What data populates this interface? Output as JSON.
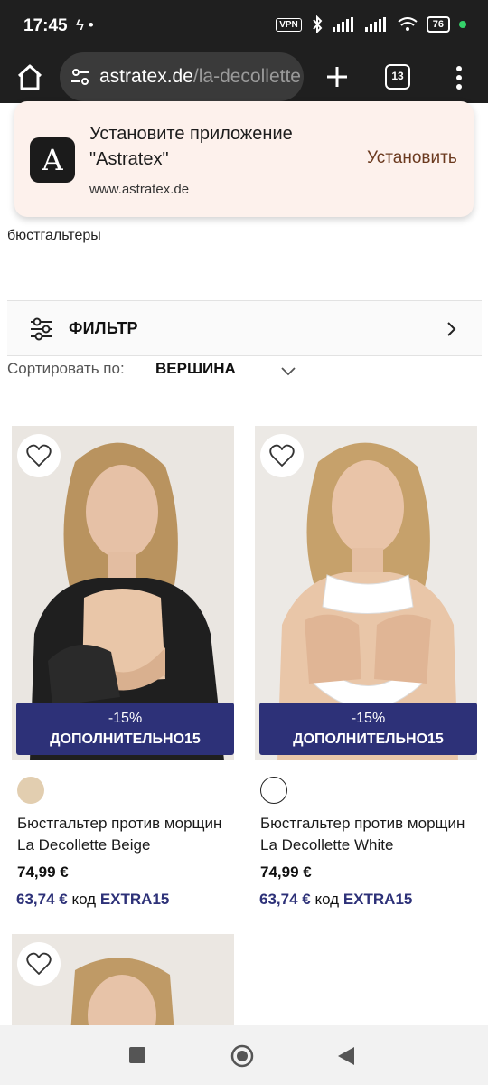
{
  "status_bar": {
    "time": "17:45",
    "vpn": "VPN",
    "battery": "76"
  },
  "browser": {
    "url_domain": "astratex.de",
    "url_path": "/la-decollette",
    "tab_count": "13"
  },
  "install_banner": {
    "title": "Установите приложение \"Astratex\"",
    "url": "www.astratex.de",
    "install_label": "Установить",
    "app_letter": "A"
  },
  "page": {
    "breadcrumb_link": "бюстгальтеры",
    "filter_label": "ФИЛЬТР",
    "sort_label": "Сортировать по:",
    "sort_value": "ВЕРШИНА"
  },
  "products": [
    {
      "name": "Бюстгальтер против морщин La Decollette Beige",
      "price": "74,99 €",
      "sale_price": "63,74 €",
      "code_label": "код",
      "code": "EXTRA15",
      "badge_line1": "-15%",
      "badge_line2": "ДОПОЛНИТЕЛЬНО15",
      "swatch_color": "#e2ceb0"
    },
    {
      "name": "Бюстгальтер против морщин La Decollette White",
      "price": "74,99 €",
      "sale_price": "63,74 €",
      "code_label": "код",
      "code": "EXTRA15",
      "badge_line1": "-15%",
      "badge_line2": "ДОПОЛНИТЕЛЬНО15",
      "swatch_color": "#ffffff"
    }
  ],
  "colors": {
    "accent": "#2d3178",
    "banner_bg": "#fdf1ec"
  }
}
